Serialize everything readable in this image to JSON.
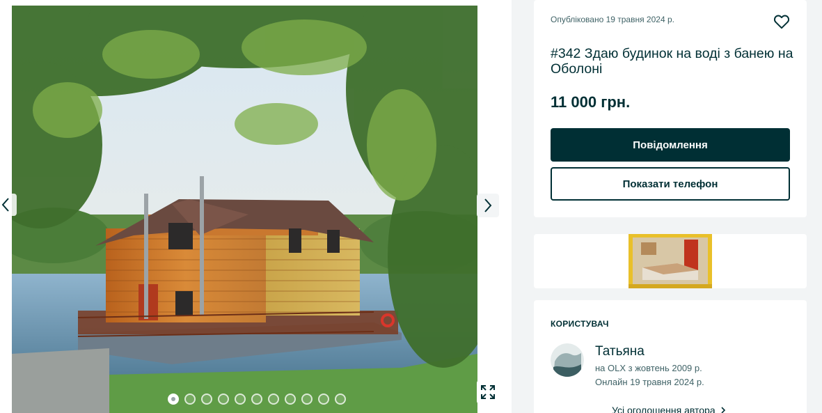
{
  "gallery": {
    "photo_count": 11,
    "active_index": 0,
    "icons": {
      "prev": "chevron-left-icon",
      "next": "chevron-right-icon",
      "expand": "expand-icon"
    }
  },
  "listing": {
    "posted": "Опубліковано 19 травня 2024 р.",
    "title": "#342 Здаю будинок на воді з банею на Оболоні",
    "price": "11 000 грн.",
    "message_button": "Повідомлення",
    "phone_button": "Показати телефон",
    "favorite_icon": "heart-icon"
  },
  "user": {
    "heading": "КОРИСТУВАЧ",
    "name": "Татьяна",
    "since": "на OLX з жовтень 2009 р.",
    "online": "Онлайн 19 травня 2024 р.",
    "all_ads": "Усі оголошення автора"
  },
  "colors": {
    "primary": "#002f34",
    "background": "#f2f4f5",
    "muted_text": "#406367"
  }
}
